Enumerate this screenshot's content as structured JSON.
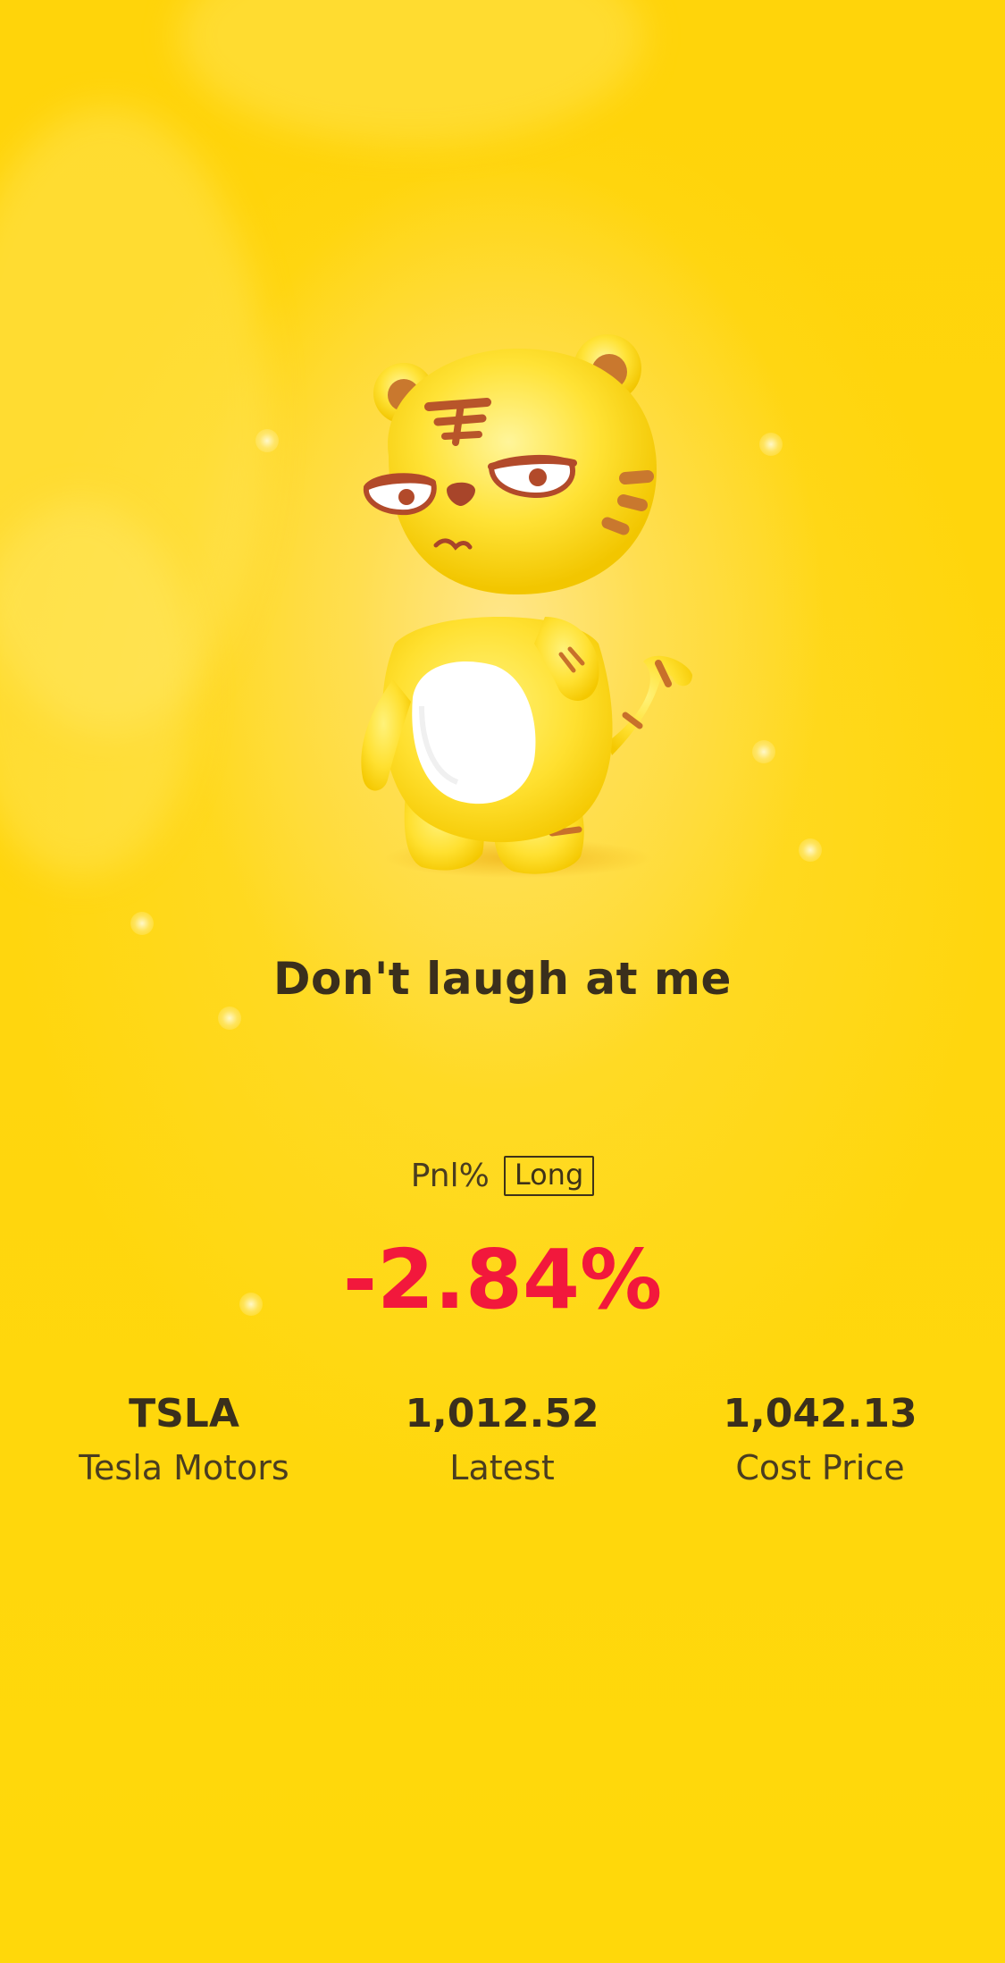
{
  "headline": "Don't laugh at me",
  "pnl": {
    "label": "Pnl%",
    "position": "Long",
    "value": "-2.84%"
  },
  "stats": [
    {
      "value": "TSLA",
      "label": "Tesla Motors"
    },
    {
      "value": "1,012.52",
      "label": "Latest"
    },
    {
      "value": "1,042.13",
      "label": "Cost Price"
    }
  ],
  "colors": {
    "background": "#FFD60A",
    "loss": "#F2183C",
    "text": "#3a2f1c"
  },
  "icons": {
    "mascot": "tiger-mascot-icon"
  }
}
